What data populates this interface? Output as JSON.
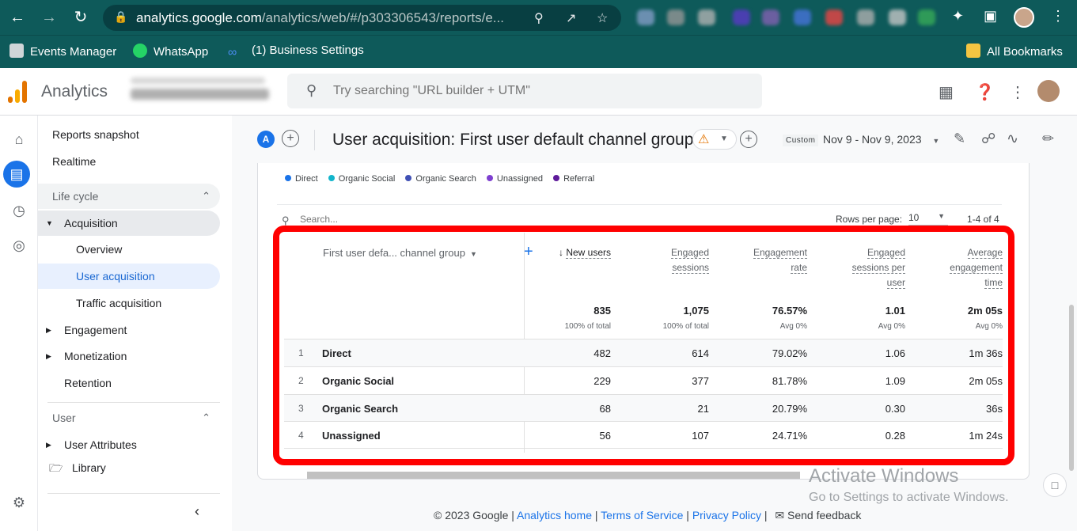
{
  "browser": {
    "url_main": "analytics.google.com",
    "url_rest": "/analytics/web/#/p303306543/reports/e...",
    "bookmarks": [
      {
        "label": "Events Manager",
        "icon": "events-manager-icon"
      },
      {
        "label": "WhatsApp",
        "icon": "whatsapp-icon"
      },
      {
        "label": "(1) Business Settings",
        "icon": "meta-icon"
      }
    ],
    "all_bookmarks": "All Bookmarks"
  },
  "app": {
    "name": "Analytics",
    "search_placeholder": "Try searching \"URL builder + UTM\""
  },
  "sidebar": {
    "reports_snapshot": "Reports snapshot",
    "realtime": "Realtime",
    "life_cycle": "Life cycle",
    "acquisition": "Acquisition",
    "overview": "Overview",
    "user_acquisition": "User acquisition",
    "traffic_acquisition": "Traffic acquisition",
    "engagement": "Engagement",
    "monetization": "Monetization",
    "retention": "Retention",
    "user": "User",
    "user_attributes": "User Attributes",
    "library": "Library"
  },
  "report": {
    "badge": "A",
    "title": "User acquisition: First user default channel group",
    "custom": "Custom",
    "date_range": "Nov 9 - Nov 9, 2023"
  },
  "legend": [
    {
      "label": "Direct",
      "color": "#1a73e8"
    },
    {
      "label": "Organic Social",
      "color": "#12b5cb"
    },
    {
      "label": "Organic Search",
      "color": "#4050b5"
    },
    {
      "label": "Unassigned",
      "color": "#7e3fd0"
    },
    {
      "label": "Referral",
      "color": "#5e1a9a"
    }
  ],
  "table": {
    "search_placeholder": "Search...",
    "rows_per_page_label": "Rows per page:",
    "rows_per_page": "10",
    "pager": "1-4 of 4",
    "dimension_header": "First user defa... channel group",
    "columns": [
      {
        "lines": [
          "New users"
        ],
        "total": "835",
        "sub": "100% of total"
      },
      {
        "lines": [
          "Engaged",
          "sessions"
        ],
        "total": "1,075",
        "sub": "100% of total"
      },
      {
        "lines": [
          "Engagement",
          "rate"
        ],
        "total": "76.57%",
        "sub": "Avg 0%"
      },
      {
        "lines": [
          "Engaged",
          "sessions per",
          "user"
        ],
        "total": "1.01",
        "sub": "Avg 0%"
      },
      {
        "lines": [
          "Average",
          "engagement",
          "time"
        ],
        "total": "2m 05s",
        "sub": "Avg 0%"
      }
    ],
    "rows": [
      {
        "n": "1",
        "name": "Direct",
        "vals": [
          "482",
          "614",
          "79.02%",
          "1.06",
          "1m 36s"
        ]
      },
      {
        "n": "2",
        "name": "Organic Social",
        "vals": [
          "229",
          "377",
          "81.78%",
          "1.09",
          "2m 05s"
        ]
      },
      {
        "n": "3",
        "name": "Organic Search",
        "vals": [
          "68",
          "21",
          "20.79%",
          "0.30",
          "36s"
        ]
      },
      {
        "n": "4",
        "name": "Unassigned",
        "vals": [
          "56",
          "107",
          "24.71%",
          "0.28",
          "1m 24s"
        ]
      }
    ]
  },
  "footer": {
    "copyright": "© 2023 Google |",
    "analytics_home": "Analytics home",
    "terms": "Terms of Service",
    "privacy": "Privacy Policy",
    "feedback": "Send feedback"
  },
  "watermark": {
    "line1": "Activate Windows",
    "line2": "Go to Settings to activate Windows."
  }
}
